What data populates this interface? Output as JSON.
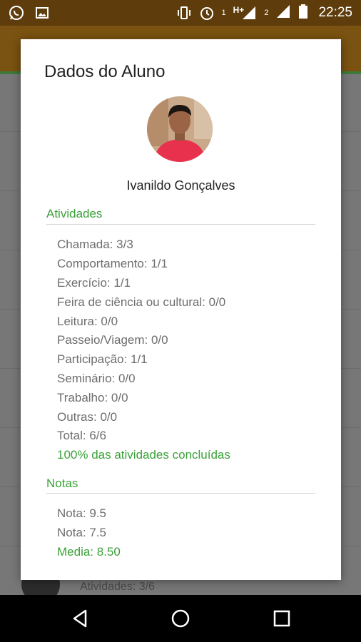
{
  "status_bar": {
    "sim1_label": "1",
    "network_label": "H+",
    "sim2_label": "2",
    "time": "22:25",
    "icons": [
      "whatsapp-icon",
      "image-icon",
      "vibrate-icon",
      "alarm-icon",
      "signal-icon",
      "signal-icon",
      "battery-icon"
    ]
  },
  "background": {
    "list_text": "Atividades: 3/6"
  },
  "dialog": {
    "title": "Dados do Aluno",
    "student_name": "Ivanildo Gonçalves",
    "activities_header": "Atividades",
    "activities": [
      "Chamada: 3/3",
      "Comportamento: 1/1",
      "Exercício: 1/1",
      "Feira de ciência ou cultural: 0/0",
      "Leitura: 0/0",
      "Passeio/Viagem: 0/0",
      "Participação: 1/1",
      "Seminário: 0/0",
      "Trabalho: 0/0",
      "Outras: 0/0",
      "Total: 6/6"
    ],
    "activities_summary": "100% das atividades concluídas",
    "grades_header": "Notas",
    "grades": [
      "Nota: 9.5",
      "Nota: 7.5"
    ],
    "average": "Media: 8.50"
  },
  "nav_bar": {
    "icons": [
      "back-icon",
      "home-icon",
      "recents-icon"
    ]
  },
  "colors": {
    "accent_green": "#3aa138",
    "status_bar": "#5e3c0b",
    "text_gray": "#6e6e6e"
  }
}
